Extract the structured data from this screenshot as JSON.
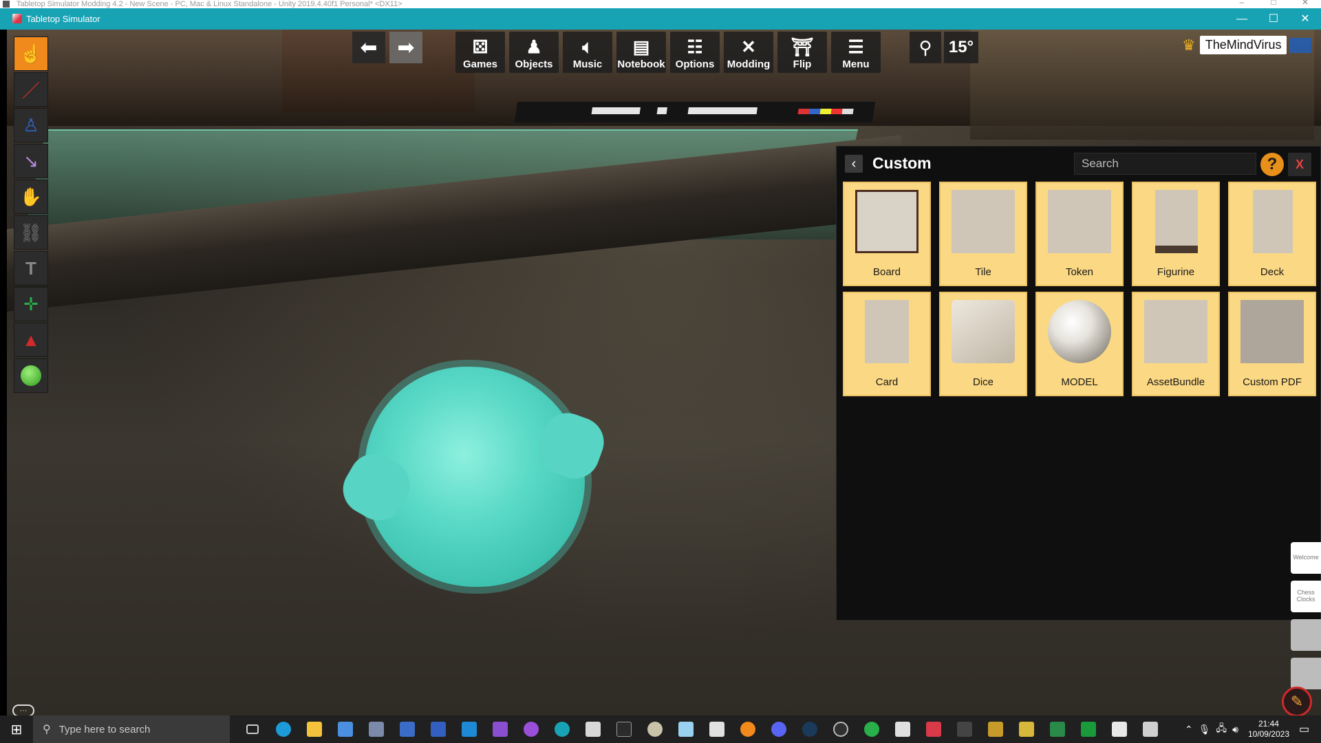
{
  "outer_window": {
    "title": "Tabletop Simulator Modding 4.2 - New Scene - PC, Mac & Linux Standalone - Unity 2019.4.40f1 Personal* <DX11>"
  },
  "window": {
    "title": "Tabletop Simulator"
  },
  "toolbar": {
    "items": [
      {
        "label": "Games",
        "icon": "dice-icon"
      },
      {
        "label": "Objects",
        "icon": "pawn-icon"
      },
      {
        "label": "Music",
        "icon": "speaker-icon"
      },
      {
        "label": "Notebook",
        "icon": "notebook-icon"
      },
      {
        "label": "Options",
        "icon": "sliders-icon"
      },
      {
        "label": "Modding",
        "icon": "tools-icon"
      },
      {
        "label": "Flip",
        "icon": "flip-icon"
      },
      {
        "label": "Menu",
        "icon": "hamburger-icon"
      }
    ],
    "rotation_value": "15°"
  },
  "player": {
    "name": "TheMindVirus",
    "color": "#1d5fbf"
  },
  "left_tools": [
    "grab-tool-icon",
    "pen-tool-icon",
    "line-tool-icon",
    "flick-tool-icon",
    "gizmo-hand-icon",
    "joint-tool-icon",
    "text-tool-icon",
    "axis-tool-icon",
    "stamp-tool-icon",
    "green-ball-icon"
  ],
  "custom_panel": {
    "title": "Custom",
    "search_placeholder": "Search",
    "help_label": "?",
    "close_label": "X",
    "items": [
      {
        "label": "Board"
      },
      {
        "label": "Tile"
      },
      {
        "label": "Token"
      },
      {
        "label": "Figurine"
      },
      {
        "label": "Deck"
      },
      {
        "label": "Card"
      },
      {
        "label": "Dice"
      },
      {
        "label": "MODEL"
      },
      {
        "label": "AssetBundle"
      },
      {
        "label": "Custom PDF"
      }
    ]
  },
  "side_tabs": [
    {
      "label": "Welcome"
    },
    {
      "label": "Chess Clocks"
    },
    {
      "label": "·"
    },
    {
      "label": "·"
    }
  ],
  "taskbar": {
    "search_placeholder": "Type here to search",
    "time": "21:44",
    "date": "10/09/2023"
  },
  "colors": {
    "accent_titlebar": "#18a3b5",
    "tile_background": "#fbd883",
    "active_tool": "#f08a1c"
  }
}
